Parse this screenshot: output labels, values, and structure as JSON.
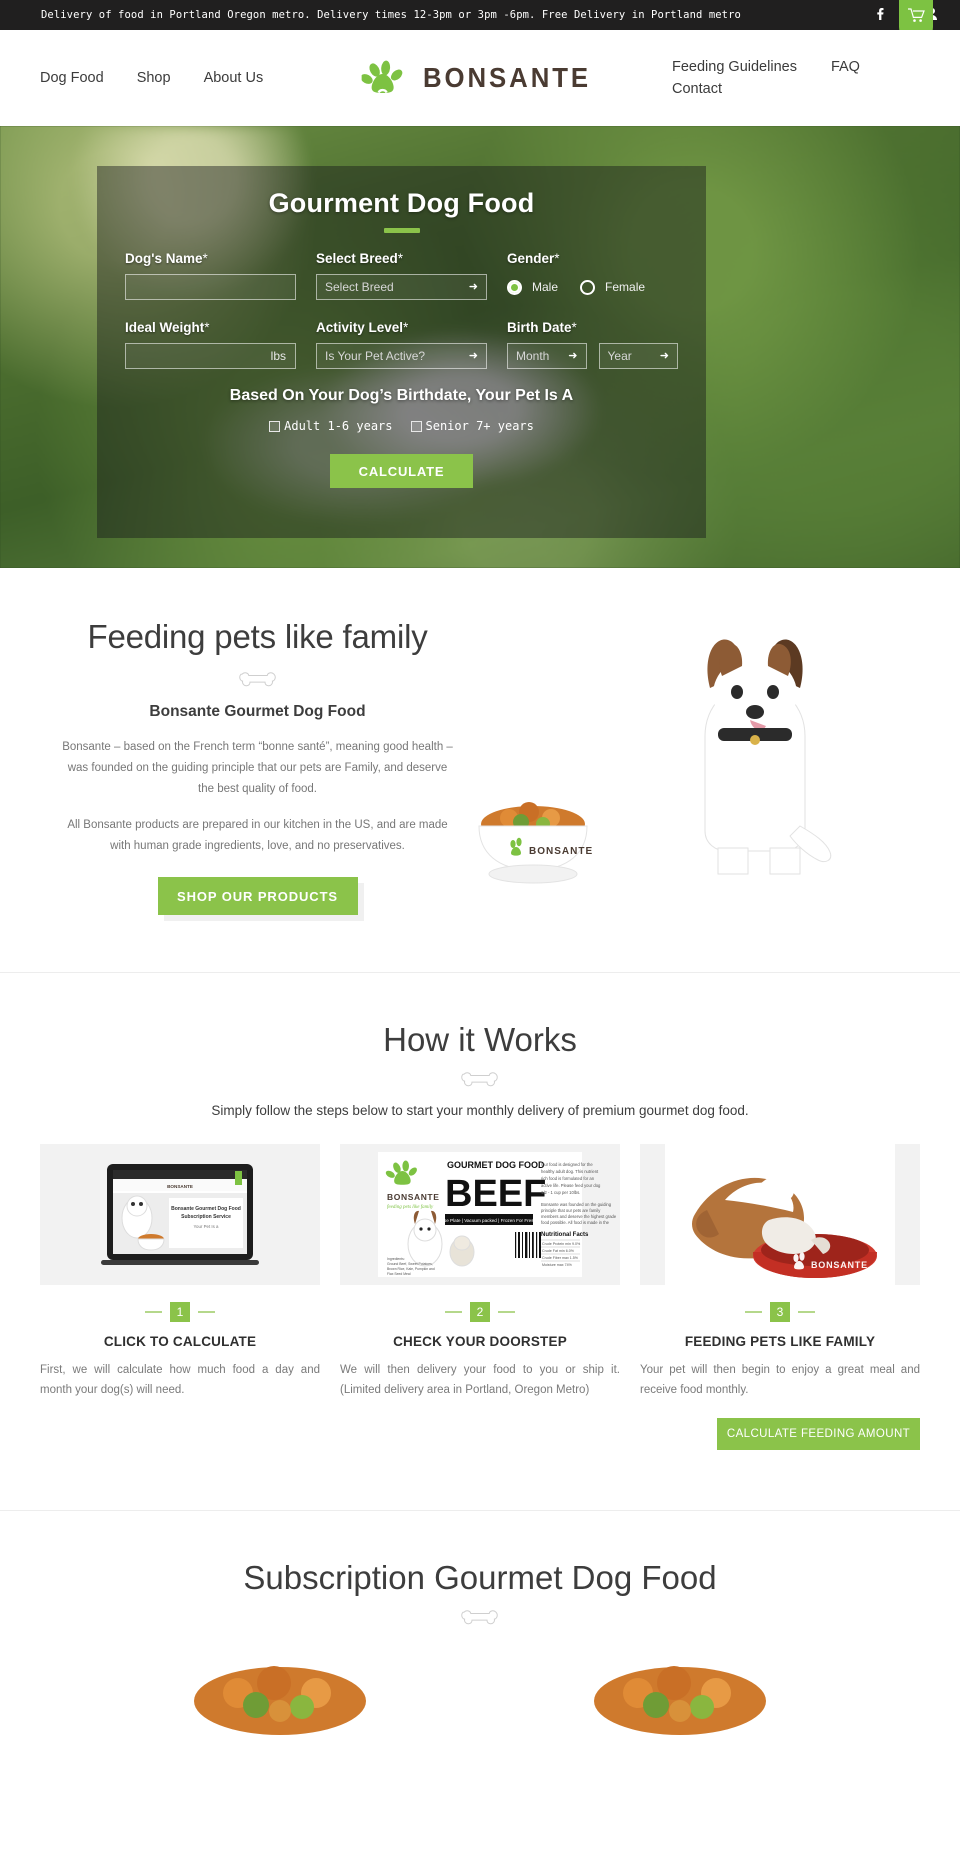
{
  "topbar": {
    "announcement": "Delivery of food in Portland Oregon metro. Delivery times 12-3pm or 3pm -6pm. Free Delivery in Portland metro",
    "social": [
      {
        "name": "facebook-icon",
        "glyph": "f"
      },
      {
        "name": "twitter-icon",
        "glyph": "ᴠ"
      },
      {
        "name": "account-icon",
        "glyph": "•"
      }
    ],
    "cart_label": "cart-icon"
  },
  "header": {
    "nav_left": [
      {
        "label": "Dog Food"
      },
      {
        "label": "Shop"
      },
      {
        "label": "About Us"
      }
    ],
    "nav_right": [
      {
        "label": "Feeding Guidelines"
      },
      {
        "label": "FAQ"
      },
      {
        "label": "Contact"
      }
    ],
    "logo_text": "BONSANTE"
  },
  "hero": {
    "title": "Gourment Dog Food",
    "fields": {
      "dog_name_label": "Dog's Name",
      "dog_name_value": "",
      "dog_name_placeholder": "",
      "breed_label": "Select Breed",
      "breed_value": "Select Breed",
      "gender_label": "Gender",
      "gender_options": [
        {
          "label": "Male",
          "selected": true
        },
        {
          "label": "Female",
          "selected": false
        }
      ],
      "weight_label": "Ideal Weight",
      "weight_value": "",
      "weight_unit": "lbs",
      "activity_label": "Activity Level",
      "activity_value": "Is Your Pet Active?",
      "birth_label": "Birth Date",
      "birth_month_value": "Month",
      "birth_year_value": "Year",
      "required_mark": "*"
    },
    "subheading": "Based On Your Dog’s Birthdate, Your Pet Is A",
    "age_options": [
      {
        "label": "Adult 1-6 years",
        "checked": false
      },
      {
        "label": "Senior 7+ years",
        "checked": false
      }
    ],
    "calculate_button": "CALCULATE"
  },
  "feeding": {
    "heading": "Feeding pets like family",
    "subheading": "Bonsante Gourmet Dog Food",
    "paragraph1": "Bonsante – based on the French term “bonne santé”, meaning good health – was founded on the guiding principle that our pets are Family, and deserve the best quality of food.",
    "paragraph2": "All Bonsante products are prepared in our kitchen in the US, and are made with human grade ingredients, love, and no preservatives.",
    "button": "SHOP OUR PRODUCTS"
  },
  "how_it_works": {
    "title": "How it Works",
    "subtitle": "Simply follow the steps below to start your monthly delivery of premium gourmet dog food.",
    "cards": [
      {
        "step": "1",
        "title": "CLICK TO CALCULATE",
        "desc": "First, we will calculate how much food a day and month your dog(s) will need.",
        "image": "laptop-screenshot-image"
      },
      {
        "step": "2",
        "title": "CHECK YOUR DOORSTEP",
        "desc": "We will then delivery your food to you or ship it. (Limited delivery area in Portland, Oregon Metro)",
        "image": "beef-label-image"
      },
      {
        "step": "3",
        "title": "FEEDING PETS LIKE FAMILY",
        "desc": "Your pet will then begin to enjoy a great meal and receive food monthly.",
        "image": "bulldog-eating-image"
      }
    ],
    "cta_button": "CALCULATE FEEDING AMOUNT"
  },
  "subscription": {
    "title": "Subscription Gourmet Dog Food"
  },
  "colors": {
    "accent_green": "#8bc34a",
    "cart_green": "#7dc242",
    "logo_brown": "#4a3b32",
    "dark_bar": "#201f1f"
  }
}
